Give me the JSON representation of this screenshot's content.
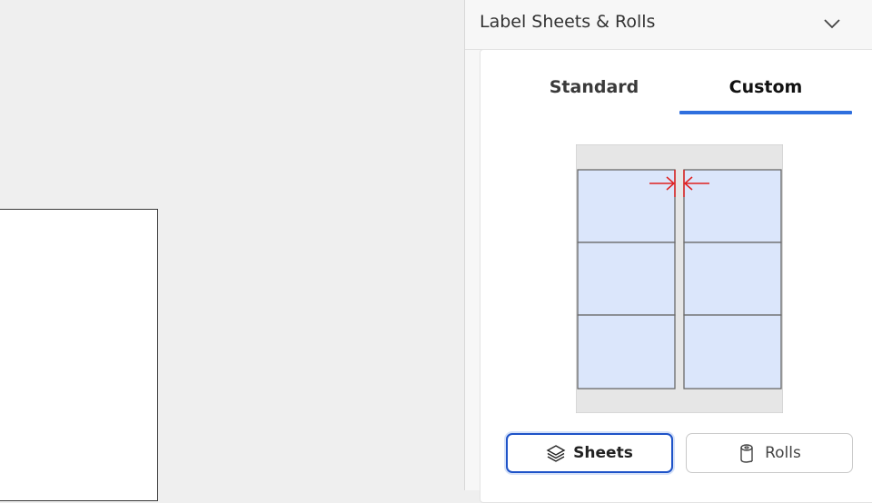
{
  "panel": {
    "title": "Label Sheets & Rolls",
    "collapse_icon": "chevron-down-icon"
  },
  "tabs": [
    {
      "label": "Standard",
      "selected": false
    },
    {
      "label": "Custom",
      "selected": true
    }
  ],
  "preview": {
    "description_icon": "label-sheet-gap-diagram",
    "accent_color": "#e02020",
    "label_fill": "#dbe6fb"
  },
  "buttons": {
    "sheets": {
      "label": "Sheets",
      "icon": "stack-icon",
      "selected": true
    },
    "rolls": {
      "label": "Rolls",
      "icon": "roll-icon",
      "selected": false
    }
  },
  "colors": {
    "tab_underline": "#2f6fde",
    "selected_border": "#1e53c8"
  }
}
